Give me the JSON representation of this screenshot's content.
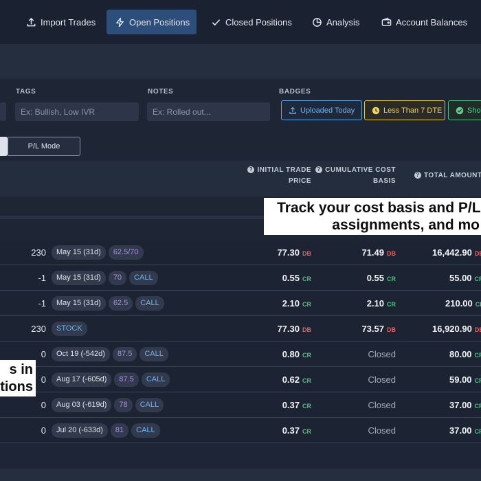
{
  "nav": {
    "tabs": [
      {
        "label": "Import Trades",
        "icon": "upload-icon",
        "active": false
      },
      {
        "label": "Open Positions",
        "icon": "lightning-icon",
        "active": true
      },
      {
        "label": "Closed Positions",
        "icon": "check-icon",
        "active": false
      },
      {
        "label": "Analysis",
        "icon": "pie-chart-icon",
        "active": false
      },
      {
        "label": "Account Balances",
        "icon": "wallet-icon",
        "active": false
      }
    ]
  },
  "filters": {
    "tags_label": "TAGS",
    "tags_placeholder": "Ex: Bullish, Low IVR",
    "notes_label": "NOTES",
    "notes_placeholder": "Ex: Rolled out...",
    "badges_label": "BADGES",
    "badges": [
      {
        "label": "Uploaded Today",
        "icon": "upload-icon",
        "color": "#5aa9e6"
      },
      {
        "label": "Less Than 7 DTE",
        "icon": "clock-icon",
        "color": "#e3c84a"
      },
      {
        "label": "Sho",
        "icon": "check-circle-icon",
        "color": "#4fbf7a"
      }
    ]
  },
  "mode": {
    "pl_mode_label": "P/L Mode"
  },
  "columns": {
    "initial_price": [
      "INITIAL TRADE",
      "PRICE"
    ],
    "cumulative_basis": [
      "CUMULATIVE COST",
      "BASIS"
    ],
    "total_amount": "TOTAL AMOUNT"
  },
  "rows": [
    {
      "qty": "230",
      "pills": [
        {
          "text": "May 15 (31d)",
          "kind": "date"
        },
        {
          "text": "62.5/70",
          "kind": "strike"
        }
      ],
      "initial": "77.30",
      "initial_tag": "DB",
      "basis": "71.49",
      "basis_tag": "DB",
      "total": "16,442.90",
      "total_tag": "DB"
    },
    {
      "qty": "-1",
      "pills": [
        {
          "text": "May 15 (31d)",
          "kind": "date"
        },
        {
          "text": "70",
          "kind": "strike"
        },
        {
          "text": "CALL",
          "kind": "type"
        }
      ],
      "initial": "0.55",
      "initial_tag": "CR",
      "basis": "0.55",
      "basis_tag": "CR",
      "total": "55.00",
      "total_tag": "CR"
    },
    {
      "qty": "-1",
      "pills": [
        {
          "text": "May 15 (31d)",
          "kind": "date"
        },
        {
          "text": "62.5",
          "kind": "strike"
        },
        {
          "text": "CALL",
          "kind": "type"
        }
      ],
      "initial": "2.10",
      "initial_tag": "CR",
      "basis": "2.10",
      "basis_tag": "CR",
      "total": "210.00",
      "total_tag": "CR"
    },
    {
      "qty": "230",
      "pills": [
        {
          "text": "STOCK",
          "kind": "type"
        }
      ],
      "initial": "77.30",
      "initial_tag": "DB",
      "basis": "73.57",
      "basis_tag": "DB",
      "total": "16,920.90",
      "total_tag": "DB"
    },
    {
      "qty": "0",
      "pills": [
        {
          "text": "Oct 19 (-542d)",
          "kind": "date"
        },
        {
          "text": "87.5",
          "kind": "strike"
        },
        {
          "text": "CALL",
          "kind": "type"
        }
      ],
      "initial": "0.80",
      "initial_tag": "CR",
      "basis": "Closed",
      "basis_tag": "",
      "total": "80.00",
      "total_tag": "CR"
    },
    {
      "qty": "0",
      "pills": [
        {
          "text": "Aug 17 (-605d)",
          "kind": "date"
        },
        {
          "text": "87.5",
          "kind": "strike"
        },
        {
          "text": "CALL",
          "kind": "type"
        }
      ],
      "initial": "0.62",
      "initial_tag": "CR",
      "basis": "Closed",
      "basis_tag": "",
      "total": "59.00",
      "total_tag": "CR"
    },
    {
      "qty": "0",
      "pills": [
        {
          "text": "Aug 03 (-619d)",
          "kind": "date"
        },
        {
          "text": "78",
          "kind": "strike"
        },
        {
          "text": "CALL",
          "kind": "type"
        }
      ],
      "initial": "0.37",
      "initial_tag": "CR",
      "basis": "Closed",
      "basis_tag": "",
      "total": "37.00",
      "total_tag": "CR"
    },
    {
      "qty": "0",
      "pills": [
        {
          "text": "Jul 20 (-633d)",
          "kind": "date"
        },
        {
          "text": "81",
          "kind": "strike"
        },
        {
          "text": "CALL",
          "kind": "type"
        }
      ],
      "initial": "0.37",
      "initial_tag": "CR",
      "basis": "Closed",
      "basis_tag": "",
      "total": "37.00",
      "total_tag": "CR"
    }
  ],
  "callouts": {
    "main_line1": "Track your cost basis and P/L t",
    "main_line2": "assignments, and mo",
    "left_line1": "s in",
    "left_line2": "tions"
  }
}
